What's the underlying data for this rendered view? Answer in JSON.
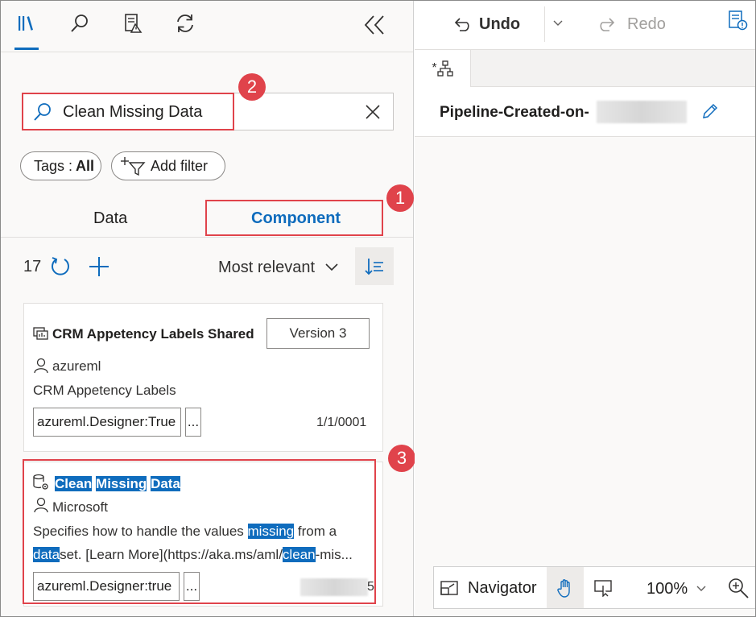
{
  "left_toolbar": {
    "icons": [
      "library-icon",
      "search-icon",
      "checklist-warning-icon",
      "refresh-icon",
      "collapse-icon"
    ]
  },
  "search": {
    "value": "Clean Missing Data"
  },
  "filters": {
    "tags_label": "Tags : ",
    "tags_value": "All",
    "add_filter_label": "Add filter"
  },
  "tabs": {
    "data": "Data",
    "component": "Component"
  },
  "results": {
    "count": "17",
    "sort_label": "Most relevant"
  },
  "cards": [
    {
      "title": "CRM Appetency Labels Shared",
      "version_label": "Version 3",
      "author": "azureml",
      "description": "CRM Appetency Labels",
      "tag": "azureml.Designer:True",
      "more": "...",
      "date": "1/1/0001"
    },
    {
      "title_words": [
        "Clean",
        "Missing",
        "Data"
      ],
      "author": "Microsoft",
      "desc1_pre": "Specifies how to handle the values ",
      "desc1_hl": "missing",
      "desc1_post": " from a",
      "desc2_hl1": "data",
      "desc2_mid": "set. [Learn More](https://aka.ms/aml/",
      "desc2_hl2": "clean",
      "desc2_post": "-mis...",
      "tag": "azureml.Designer:true",
      "more": "...",
      "date_tail": "5"
    }
  ],
  "annotations": {
    "badge1": "1",
    "badge2": "2",
    "badge3": "3"
  },
  "right_toolbar": {
    "undo_label": "Undo",
    "redo_label": "Redo"
  },
  "doc_tab": {
    "label": "*"
  },
  "pipeline": {
    "title": "Pipeline-Created-on-"
  },
  "navigator": {
    "label": "Navigator",
    "zoom": "100%"
  },
  "colors": {
    "accent": "#0f6cbd",
    "annotation_red": "#e0434b"
  }
}
